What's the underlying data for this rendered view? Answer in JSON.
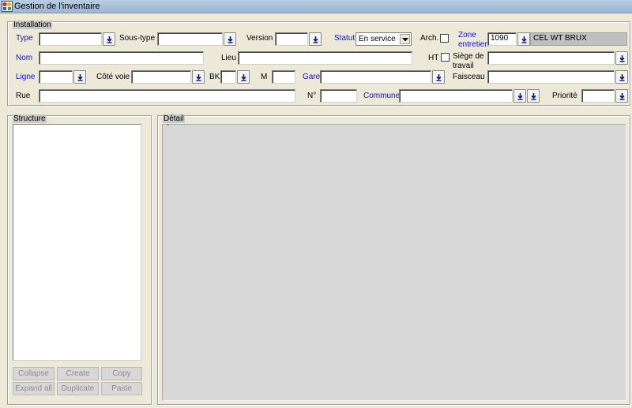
{
  "window": {
    "title": "Gestion de l'inventaire"
  },
  "installation": {
    "group_title": "Installation",
    "type_label": "Type",
    "type_value": "",
    "soustype_label": "Sous-type",
    "soustype_value": "",
    "version_label": "Version",
    "version_value": "",
    "statut_label": "Statut",
    "statut_value": "En service",
    "arch_label": "Arch.",
    "zone_label_1": "Zone",
    "zone_label_2": "entretien",
    "zone_code": "1090",
    "zone_name": "CEL WT BRUX",
    "nom_label": "Nom",
    "nom_value": "",
    "lieu_label": "Lieu",
    "lieu_value": "",
    "ht_label": "HT",
    "siege_label_1": "Siège de",
    "siege_label_2": "travail",
    "siege_value": "",
    "ligne_label": "Ligne",
    "ligne_value": "",
    "cote_label": "Côté voie",
    "cote_value": "",
    "bk_label": "BK",
    "bk_value": "",
    "m_label": "M",
    "m_value": "",
    "gare_label": "Gare",
    "gare_value": "",
    "faisceau_label": "Faisceau",
    "faisceau_value": "",
    "rue_label": "Rue",
    "rue_value": "",
    "no_label": "N°",
    "no_value": "",
    "commune_label": "Commune",
    "commune_value": "",
    "priorite_label": "Priorité",
    "priorite_value": ""
  },
  "structure": {
    "group_title": "Structure",
    "buttons": {
      "collapse_all": "Collapse all",
      "create": "Create",
      "copy": "Copy",
      "expand_all": "Expand all",
      "duplicate": "Duplicate",
      "paste": "Paste"
    }
  },
  "detail": {
    "group_title": "Détail",
    "content": "`"
  },
  "colors": {
    "window_bg": "#ECE9D8",
    "blue_label": "#1414C8",
    "lookup_arrow": "#0A1E7A"
  },
  "icons": [
    "app-icon",
    "lookup-down-arrow-icon",
    "combo-down-arrow-icon"
  ]
}
